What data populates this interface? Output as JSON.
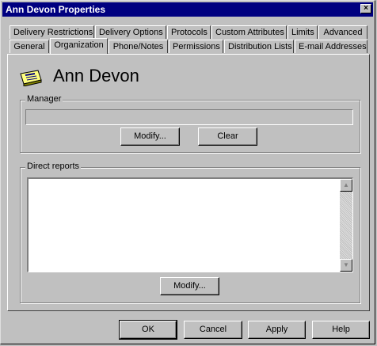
{
  "window": {
    "title": "Ann Devon Properties",
    "close_label": "×"
  },
  "tabs_row1": [
    "Delivery Restrictions",
    "Delivery Options",
    "Protocols",
    "Custom Attributes",
    "Limits",
    "Advanced"
  ],
  "tabs_row2": [
    "General",
    "Organization",
    "Phone/Notes",
    "Permissions",
    "Distribution Lists",
    "E-mail Addresses"
  ],
  "active_tab": "Organization",
  "user": {
    "name": "Ann Devon"
  },
  "manager": {
    "label": "Manager",
    "value": "",
    "modify_label": "Modify...",
    "clear_label": "Clear"
  },
  "direct_reports": {
    "label": "Direct reports",
    "items": [],
    "modify_label": "Modify..."
  },
  "footer": {
    "ok_label": "OK",
    "cancel_label": "Cancel",
    "apply_label": "Apply",
    "help_label": "Help"
  }
}
